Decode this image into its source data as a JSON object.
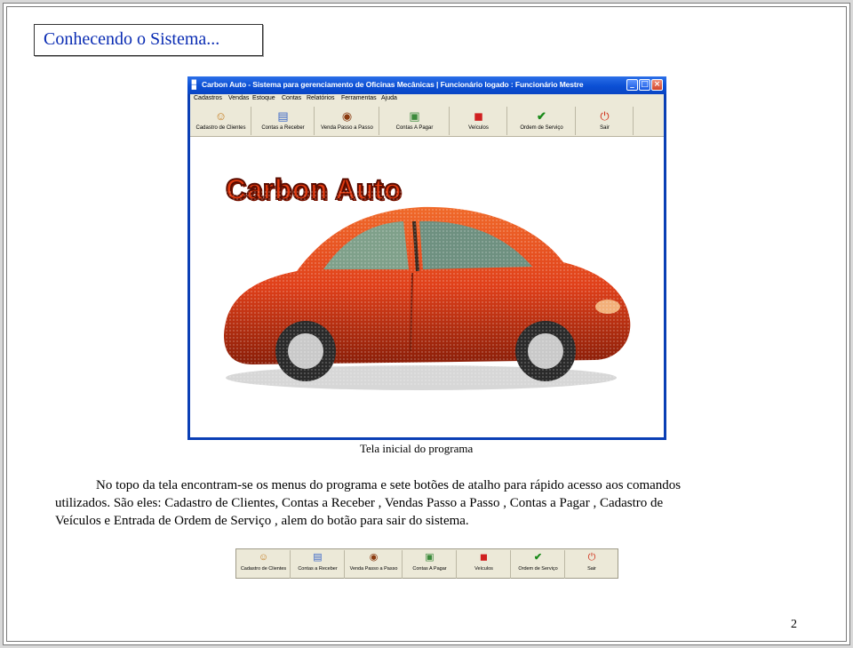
{
  "heading": "Conhecendo o Sistema...",
  "window": {
    "title": "Carbon Auto - Sistema para gerenciamento de Oficinas Mecânicas  |  Funcionário logado : Funcionário Mestre",
    "controls": [
      "minimize",
      "maximize",
      "close"
    ]
  },
  "menu": [
    "Cadastros",
    "Vendas",
    "Estoque",
    "Contas",
    "Relatórios",
    "Ferramentas",
    "Ajuda"
  ],
  "toolbar": [
    {
      "label": "Cadastro de Clientes",
      "icon": "people-icon"
    },
    {
      "label": "Contas a Receber",
      "icon": "ledger-icon"
    },
    {
      "label": "Venda Passo a Passo",
      "icon": "cart-icon"
    },
    {
      "label": "Contas A Pagar",
      "icon": "bill-icon"
    },
    {
      "label": "Veículos",
      "icon": "car-icon"
    },
    {
      "label": "Ordem de Serviço",
      "icon": "check-icon"
    },
    {
      "label": "Sair",
      "icon": "exit-icon"
    }
  ],
  "strip_toolbar": [
    {
      "label": "Cadastro de Clientes",
      "icon": "people-icon"
    },
    {
      "label": "Contas a Receber",
      "icon": "ledger-icon"
    },
    {
      "label": "Venda Passo a Passo",
      "icon": "cart-icon"
    },
    {
      "label": "Contas A Pagar",
      "icon": "bill-icon"
    },
    {
      "label": "Veículos",
      "icon": "car-icon"
    },
    {
      "label": "Ordem de Serviço",
      "icon": "check-icon"
    },
    {
      "label": "Sair",
      "icon": "exit-icon"
    }
  ],
  "logo": "Carbon Auto",
  "caption": "Tela inicial do programa",
  "paragraph": [
    "No topo da tela encontram-se os menus do programa e sete botões de atalho para rápido acesso aos comandos",
    "utilizados. São eles: Cadastro de Clientes, Contas a Receber , Vendas Passo a Passo , Contas a Pagar , Cadastro de",
    "Veículos e Entrada de Ordem de Serviço , alem do botão para sair do sistema."
  ],
  "page_number": "2",
  "colors": {
    "heading": "#0a2cb3",
    "titlebar": "#0b4fd4",
    "toolbar_bg": "#ece9d8",
    "logo": "#e13a10",
    "car_body": "#e0401a"
  }
}
